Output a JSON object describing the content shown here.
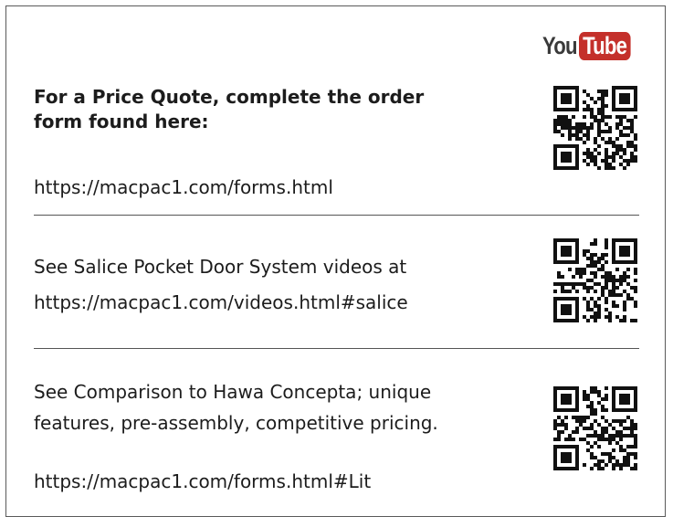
{
  "logo": {
    "you": "You",
    "tube": "Tube",
    "brand_color": "#c4302b"
  },
  "sections": [
    {
      "heading_lines": [
        "For a Price Quote, complete the order",
        "form found here:"
      ],
      "url": "https://macpac1.com/forms.html",
      "qr_icon": "qr-code-icon"
    },
    {
      "lines": [
        "See Salice Pocket Door System videos at",
        "https://macpac1.com/videos.html#salice"
      ],
      "qr_icon": "qr-code-icon"
    },
    {
      "lines": [
        "See Comparison to Hawa Concepta;  unique",
        "features, pre-assembly, competitive pricing."
      ],
      "url": "https://macpac1.com/forms.html#Lit",
      "qr_icon": "qr-code-icon"
    }
  ]
}
